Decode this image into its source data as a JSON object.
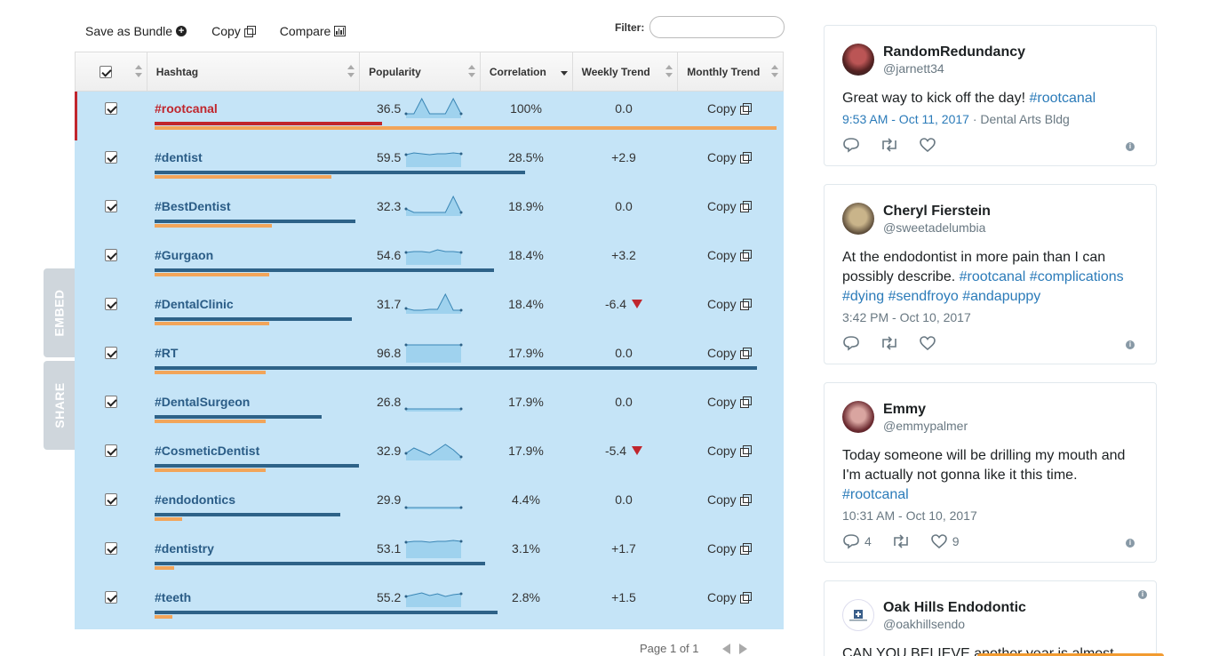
{
  "toolbar": {
    "save_bundle": "Save as Bundle",
    "copy": "Copy",
    "compare": "Compare",
    "filter_label": "Filter:",
    "filter_value": ""
  },
  "table": {
    "columns": [
      "Hashtag",
      "Popularity",
      "Correlation",
      "Weekly Trend",
      "Monthly Trend"
    ],
    "copy_label": "Copy",
    "rows": [
      {
        "tag": "#rootcanal",
        "popularity": "36.5",
        "correlation": "100%",
        "weekly": "0.0",
        "down": false,
        "pop_frac": 0.365,
        "corr_frac": 1.0,
        "spark": [
          5,
          5,
          22,
          5,
          5,
          5,
          22,
          5
        ]
      },
      {
        "tag": "#dentist",
        "popularity": "59.5",
        "correlation": "28.5%",
        "weekly": "+2.9",
        "down": false,
        "pop_frac": 0.595,
        "corr_frac": 0.285,
        "spark": [
          14,
          16,
          15,
          14,
          15,
          15,
          16,
          15
        ]
      },
      {
        "tag": "#BestDentist",
        "popularity": "32.3",
        "correlation": "18.9%",
        "weekly": "0.0",
        "down": false,
        "pop_frac": 0.323,
        "corr_frac": 0.189,
        "spark": [
          8,
          4,
          4,
          4,
          4,
          4,
          22,
          4
        ]
      },
      {
        "tag": "#Gurgaon",
        "popularity": "54.6",
        "correlation": "18.4%",
        "weekly": "+3.2",
        "down": false,
        "pop_frac": 0.546,
        "corr_frac": 0.184,
        "spark": [
          14,
          15,
          15,
          14,
          17,
          15,
          15,
          14
        ]
      },
      {
        "tag": "#DentalClinic",
        "popularity": "31.7",
        "correlation": "18.4%",
        "weekly": "-6.4",
        "down": true,
        "pop_frac": 0.317,
        "corr_frac": 0.184,
        "spark": [
          6,
          4,
          4,
          5,
          5,
          22,
          4,
          4
        ]
      },
      {
        "tag": "#RT",
        "popularity": "96.8",
        "correlation": "17.9%",
        "weekly": "0.0",
        "down": false,
        "pop_frac": 0.968,
        "corr_frac": 0.179,
        "spark": [
          20,
          20,
          20,
          20,
          20,
          20,
          20,
          20
        ]
      },
      {
        "tag": "#DentalSurgeon",
        "popularity": "26.8",
        "correlation": "17.9%",
        "weekly": "0.0",
        "down": false,
        "pop_frac": 0.268,
        "corr_frac": 0.179,
        "spark": [
          3,
          3,
          3,
          3,
          3,
          3,
          3,
          3
        ]
      },
      {
        "tag": "#CosmeticDentist",
        "popularity": "32.9",
        "correlation": "17.9%",
        "weekly": "-5.4",
        "down": true,
        "pop_frac": 0.329,
        "corr_frac": 0.179,
        "spark": [
          8,
          14,
          10,
          6,
          12,
          18,
          12,
          4
        ]
      },
      {
        "tag": "#endodontics",
        "popularity": "29.9",
        "correlation": "4.4%",
        "weekly": "0.0",
        "down": false,
        "pop_frac": 0.299,
        "corr_frac": 0.044,
        "spark": [
          2,
          2,
          2,
          2,
          2,
          2,
          2,
          2
        ]
      },
      {
        "tag": "#dentistry",
        "popularity": "53.1",
        "correlation": "3.1%",
        "weekly": "+1.7",
        "down": false,
        "pop_frac": 0.531,
        "corr_frac": 0.031,
        "spark": [
          18,
          19,
          19,
          18,
          19,
          19,
          20,
          19
        ]
      },
      {
        "tag": "#teeth",
        "popularity": "55.2",
        "correlation": "2.8%",
        "weekly": "+1.5",
        "down": false,
        "pop_frac": 0.552,
        "corr_frac": 0.028,
        "spark": [
          12,
          14,
          16,
          13,
          15,
          12,
          14,
          15
        ]
      }
    ]
  },
  "pager": {
    "text": "Page 1 of 1"
  },
  "side_tabs": {
    "embed": "EMBED",
    "share": "SHARE"
  },
  "tweets": [
    {
      "name": "RandomRedundancy",
      "handle": "@jarnett34",
      "text_plain": "Great way to kick off the day! ",
      "tags": "#rootcanal",
      "time": "9:53 AM - Oct 11, 2017",
      "place": " · Dental Arts Bldg",
      "replies": "",
      "likes": ""
    },
    {
      "name": "Cheryl Fierstein",
      "handle": "@sweetadelumbia",
      "text_plain": "At the endodontist in more pain than I can possibly describe. ",
      "tags": "#rootcanal #complications #dying #sendfroyo #andapuppy",
      "time": "3:42 PM - Oct 10, 2017",
      "place": "",
      "replies": "",
      "likes": ""
    },
    {
      "name": "Emmy",
      "handle": "@emmypalmer",
      "text_plain": "Today someone will be drilling my mouth and I'm actually not gonna like it this time. ",
      "tags": "#rootcanal",
      "time": "10:31 AM - Oct 10, 2017",
      "place": "",
      "replies": "4",
      "likes": "9"
    },
    {
      "name": "Oak Hills Endodontic",
      "handle": "@oakhillsendo",
      "text_plain": "CAN YOU BELIEVE another year is almost",
      "tags": "",
      "time": "",
      "place": "",
      "replies": "",
      "likes": ""
    }
  ],
  "colors": {
    "row_bg": "#c5e4f7",
    "bar_blue": "#2e6288",
    "bar_orange": "#f2a55a",
    "selected": "#c0262d",
    "link": "#2b7bb9"
  }
}
